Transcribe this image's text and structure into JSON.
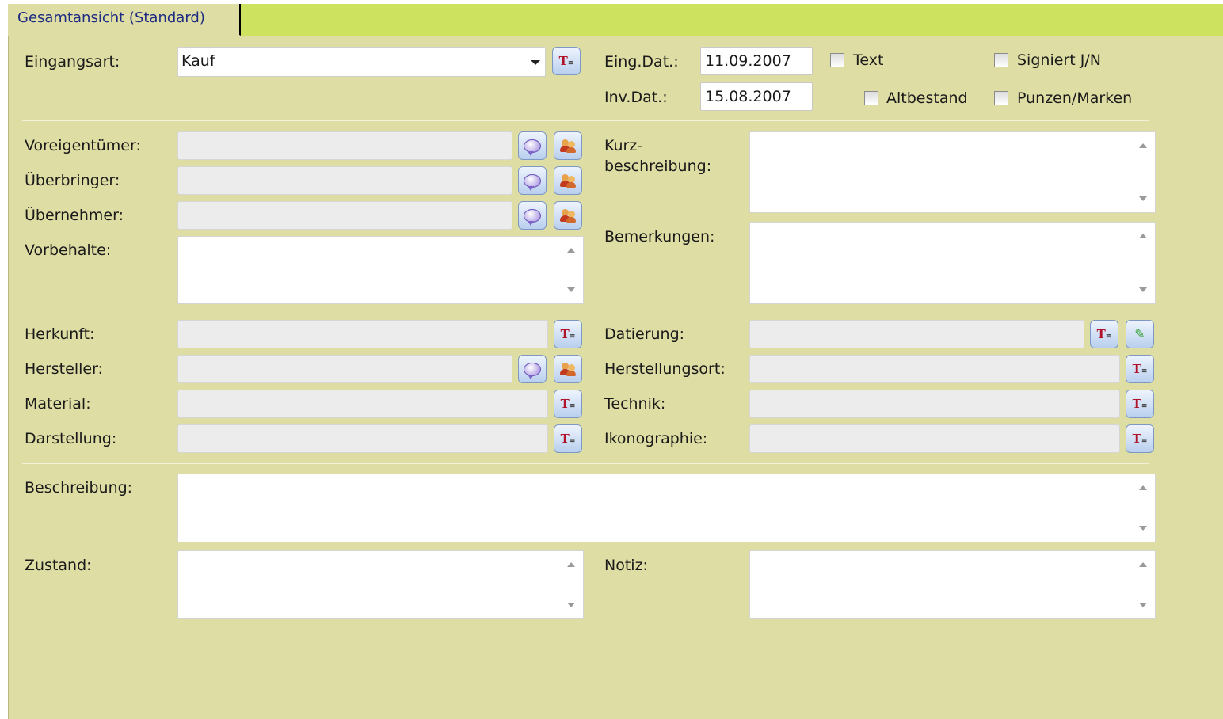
{
  "tab": {
    "label": "Gesamtansicht (Standard)"
  },
  "header": {
    "eingangsart_label": "Eingangsart:",
    "eingangsart_value": "Kauf",
    "eingdat_label": "Eing.Dat.:",
    "eingdat_value": "11.09.2007",
    "invdat_label": "Inv.Dat.:",
    "invdat_value": "15.08.2007",
    "text_label": "Text",
    "signiert_label": "Signiert J/N",
    "altbestand_label": "Altbestand",
    "punzen_label": "Punzen/Marken"
  },
  "persons": {
    "voreigentuemer_label": "Voreigentümer:",
    "ueberbringer_label": "Überbringer:",
    "uebernehmer_label": "Übernehmer:",
    "vorbehalte_label": "Vorbehalte:",
    "kurzbeschreibung_label_1": "Kurz-",
    "kurzbeschreibung_label_2": "beschreibung:",
    "bemerkungen_label": "Bemerkungen:"
  },
  "details": {
    "herkunft_label": "Herkunft:",
    "hersteller_label": "Hersteller:",
    "material_label": "Material:",
    "darstellung_label": "Darstellung:",
    "datierung_label": "Datierung:",
    "herstellungsort_label": "Herstellungsort:",
    "technik_label": "Technik:",
    "ikonographie_label": "Ikonographie:"
  },
  "bottom": {
    "beschreibung_label": "Beschreibung:",
    "zustand_label": "Zustand:",
    "notiz_label": "Notiz:"
  },
  "icons": {
    "text_list": "T",
    "chat": "speech-bubble-icon",
    "persons": "persons-icon",
    "pencil": "✎"
  },
  "colors": {
    "tabbar": "#cde35f",
    "panel": "#dedda4",
    "tab_text": "#1d2a83"
  }
}
